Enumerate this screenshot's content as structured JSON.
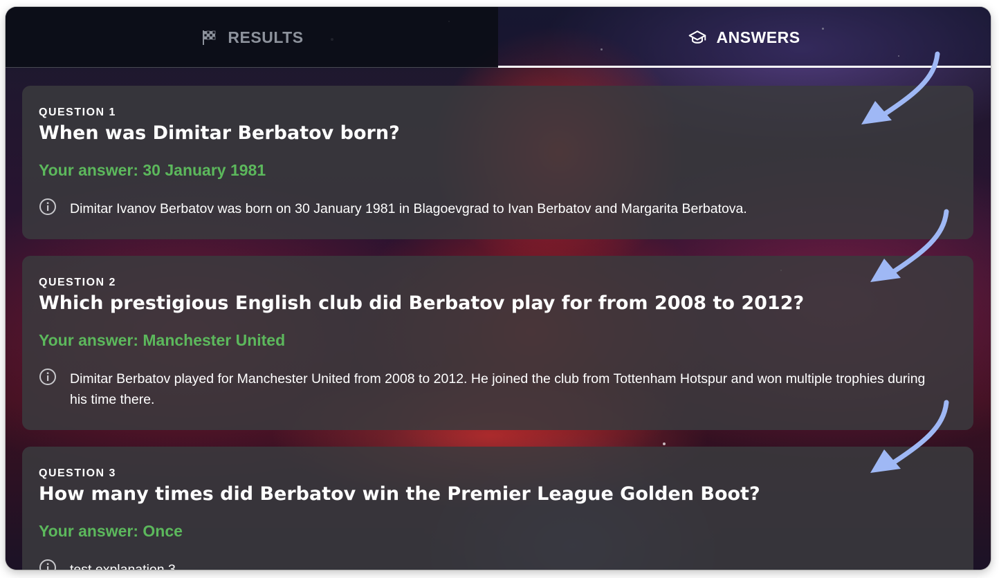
{
  "tabs": [
    {
      "label": "RESULTS",
      "icon": "checkered-flag-icon",
      "active": false
    },
    {
      "label": "ANSWERS",
      "icon": "graduation-cap-icon",
      "active": true
    }
  ],
  "questions": [
    {
      "number": "QUESTION 1",
      "title": "When was Dimitar Berbatov born?",
      "answer": "Your answer: 30 January 1981",
      "explanation": "Dimitar Ivanov Berbatov was born on 30 January 1981 in Blagoevgrad to Ivan Berbatov and Margarita Berbatova."
    },
    {
      "number": "QUESTION 2",
      "title": "Which prestigious English club did Berbatov play for from 2008 to 2012?",
      "answer": "Your answer: Manchester United",
      "explanation": "Dimitar Berbatov played for Manchester United from 2008 to 2012. He joined the club from Tottenham Hotspur and won multiple trophies during his time there."
    },
    {
      "number": "QUESTION 3",
      "title": "How many times did Berbatov win the Premier League Golden Boot?",
      "answer": "Your answer: Once",
      "explanation": "test explanation 3"
    }
  ],
  "colors": {
    "correct_answer": "#5cb85c",
    "annotation_arrow": "#9fb8f5",
    "active_tab_underline": "#ffffff"
  }
}
